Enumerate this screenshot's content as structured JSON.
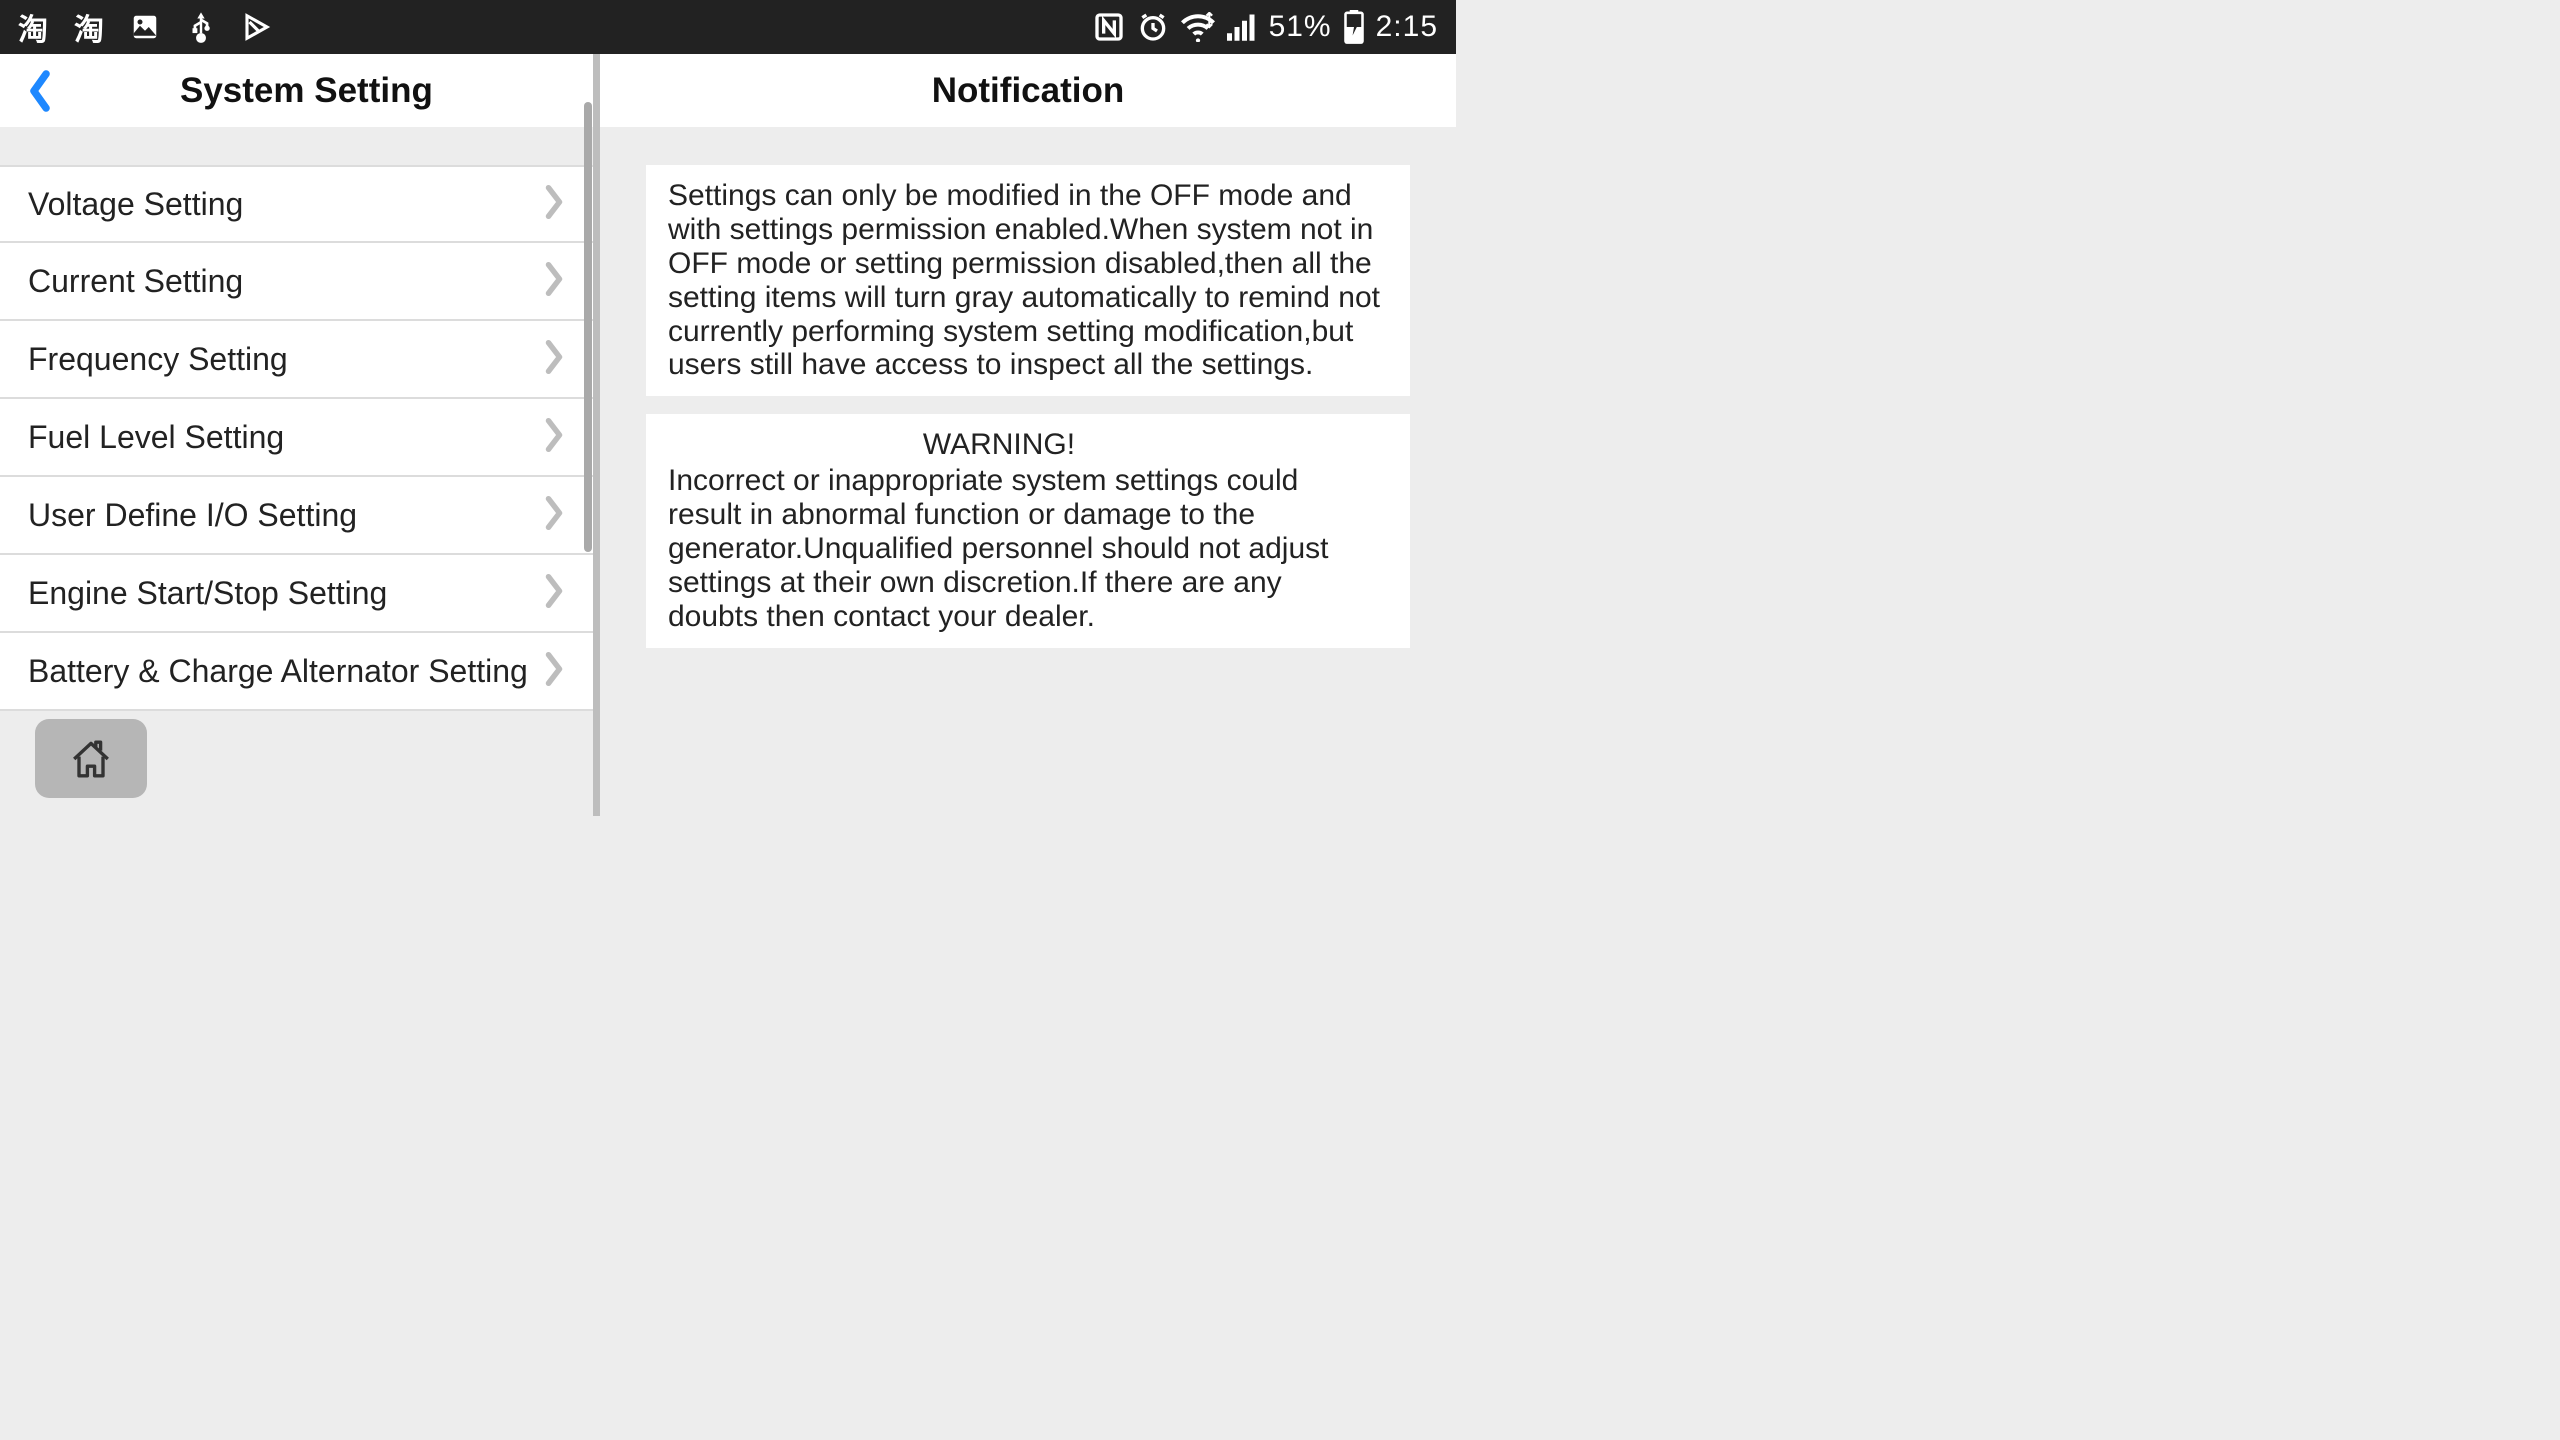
{
  "status_bar": {
    "left_icons": [
      "淘",
      "淘"
    ],
    "battery_percent": "51%",
    "time": "2:15"
  },
  "left": {
    "title": "System Setting",
    "items": [
      {
        "label": "Voltage Setting",
        "name": "voltage-setting"
      },
      {
        "label": "Current Setting",
        "name": "current-setting"
      },
      {
        "label": "Frequency Setting",
        "name": "frequency-setting"
      },
      {
        "label": "Fuel Level Setting",
        "name": "fuel-level-setting"
      },
      {
        "label": "User Define I/O Setting",
        "name": "user-define-io-setting"
      },
      {
        "label": "Engine Start/Stop Setting",
        "name": "engine-start-stop-setting"
      },
      {
        "label": "Battery & Charge Alternator Setting",
        "name": "battery-charge-alternator-setting"
      }
    ]
  },
  "right": {
    "title": "Notification",
    "notice_text": "Settings can only be modified in the OFF mode and with settings permission enabled.When system not in OFF mode or setting permission disabled,then all the setting items will turn gray automatically to remind not currently performing system setting modification,but users still have access to inspect all the settings.",
    "warning_heading": "WARNING!",
    "warning_text": "Incorrect or inappropriate system settings could result in abnormal function or damage to the generator.Unqualified personnel should not adjust settings at their own discretion.If there are any doubts then contact your dealer."
  }
}
